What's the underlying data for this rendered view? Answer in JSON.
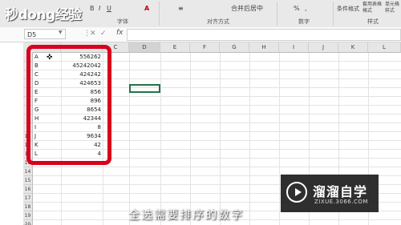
{
  "ribbon": {
    "logo": "秒dong经验",
    "groups": [
      "字体",
      "对齐方式",
      "数字",
      "样式"
    ],
    "tools": [
      "B",
      "I",
      "U",
      "A",
      "≡",
      "合并后居中",
      "%",
      ",",
      "条件格式",
      "套用表格格式",
      "单元格样式"
    ]
  },
  "formula_bar": {
    "name_box": "D5",
    "fx": "fx",
    "value": ""
  },
  "columns": [
    "A",
    "B",
    "C",
    "D",
    "E",
    "F",
    "G",
    "H",
    "I",
    "J",
    "K",
    "L"
  ],
  "rows": [
    "1",
    "2",
    "3",
    "4",
    "5",
    "6",
    "7",
    "8",
    "9",
    "10",
    "11",
    "12",
    "13",
    "14",
    "15",
    "16",
    "17",
    "18",
    "19",
    "20"
  ],
  "data": [
    {
      "a": "A",
      "b": "556262"
    },
    {
      "a": "B",
      "b": "45242042"
    },
    {
      "a": "C",
      "b": "424242"
    },
    {
      "a": "D",
      "b": "424653"
    },
    {
      "a": "E",
      "b": "856"
    },
    {
      "a": "F",
      "b": "896"
    },
    {
      "a": "G",
      "b": "8654"
    },
    {
      "a": "H",
      "b": "42344"
    },
    {
      "a": "I",
      "b": "8"
    },
    {
      "a": "J",
      "b": "9634"
    },
    {
      "a": "K",
      "b": "42"
    },
    {
      "a": "L",
      "b": "4"
    }
  ],
  "caption": "全选需要排序的数字",
  "watermark": {
    "title": "溜溜自学",
    "url": "ZIXUE.3066.COM"
  },
  "colors": {
    "highlight": "#d9001b",
    "active": "#217346"
  }
}
